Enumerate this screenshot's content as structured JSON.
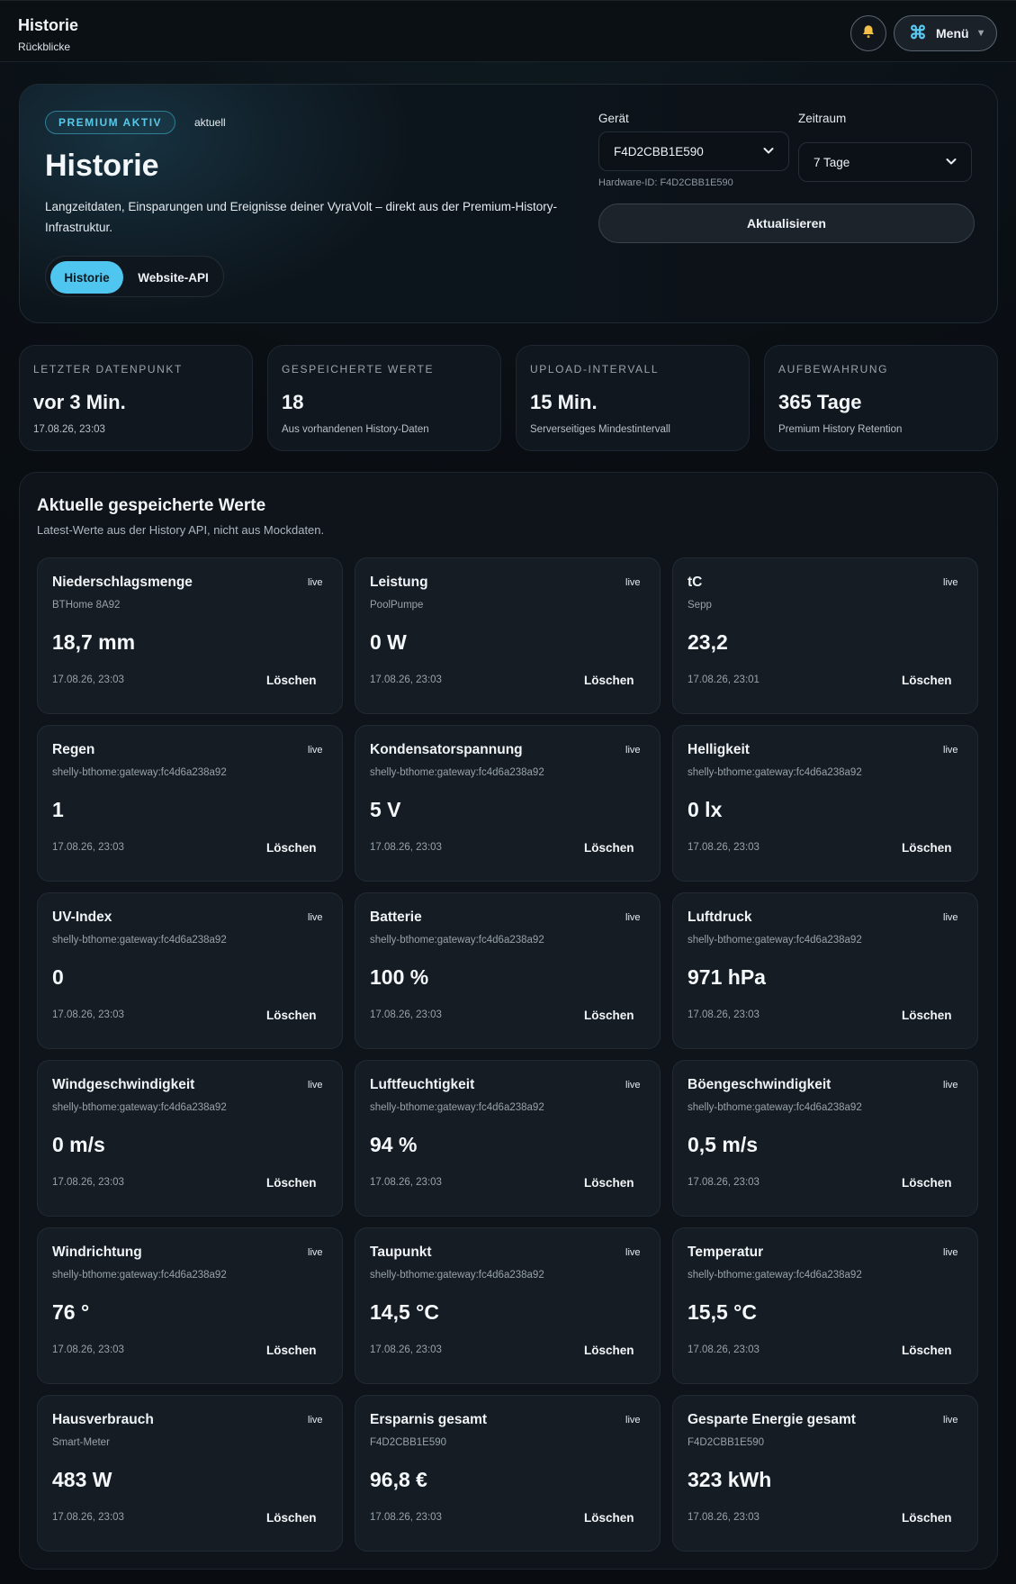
{
  "header": {
    "title": "Historie",
    "subtitle": "Rückblicke",
    "menu_label": "Menü"
  },
  "hero": {
    "badge": "PREMIUM AKTIV",
    "badge_note": "aktuell",
    "title": "Historie",
    "description": "Langzeitdaten, Einsparungen und Ereignisse deiner VyraVolt – direkt aus der Premium-History-Infrastruktur.",
    "tabs": [
      "Historie",
      "Website-API"
    ],
    "device_label": "Gerät",
    "device_value": "F4D2CBB1E590",
    "hardware_id": "Hardware-ID: F4D2CBB1E590",
    "range_label": "Zeitraum",
    "range_value": "7 Tage",
    "refresh_label": "Aktualisieren"
  },
  "stats": [
    {
      "key": "LETZTER DATENPUNKT",
      "value": "vor 3 Min.",
      "detail": "17.08.26, 23:03"
    },
    {
      "key": "GESPEICHERTE WERTE",
      "value": "18",
      "detail": "Aus vorhandenen History-Daten"
    },
    {
      "key": "UPLOAD-INTERVALL",
      "value": "15 Min.",
      "detail": "Serverseitiges Mindestintervall"
    },
    {
      "key": "AUFBEWAHRUNG",
      "value": "365 Tage",
      "detail": "Premium History Retention"
    }
  ],
  "values_section": {
    "title": "Aktuelle gespeicherte Werte",
    "subtitle": "Latest-Werte aus der History API, nicht aus Mockdaten.",
    "live_label": "live",
    "delete_label": "Löschen",
    "cards": [
      {
        "name": "Niederschlagsmenge",
        "source": "BTHome 8A92",
        "value": "18,7 mm",
        "time": "17.08.26, 23:03"
      },
      {
        "name": "Leistung",
        "source": "PoolPumpe",
        "value": "0 W",
        "time": "17.08.26, 23:03"
      },
      {
        "name": "tC",
        "source": "Sepp",
        "value": "23,2",
        "time": "17.08.26, 23:01"
      },
      {
        "name": "Regen",
        "source": "shelly-bthome:gateway:fc4d6a238a92",
        "value": "1",
        "time": "17.08.26, 23:03"
      },
      {
        "name": "Kondensatorspannung",
        "source": "shelly-bthome:gateway:fc4d6a238a92",
        "value": "5 V",
        "time": "17.08.26, 23:03"
      },
      {
        "name": "Helligkeit",
        "source": "shelly-bthome:gateway:fc4d6a238a92",
        "value": "0 lx",
        "time": "17.08.26, 23:03"
      },
      {
        "name": "UV-Index",
        "source": "shelly-bthome:gateway:fc4d6a238a92",
        "value": "0",
        "time": "17.08.26, 23:03"
      },
      {
        "name": "Batterie",
        "source": "shelly-bthome:gateway:fc4d6a238a92",
        "value": "100 %",
        "time": "17.08.26, 23:03"
      },
      {
        "name": "Luftdruck",
        "source": "shelly-bthome:gateway:fc4d6a238a92",
        "value": "971 hPa",
        "time": "17.08.26, 23:03"
      },
      {
        "name": "Windgeschwindigkeit",
        "source": "shelly-bthome:gateway:fc4d6a238a92",
        "value": "0 m/s",
        "time": "17.08.26, 23:03"
      },
      {
        "name": "Luftfeuchtigkeit",
        "source": "shelly-bthome:gateway:fc4d6a238a92",
        "value": "94 %",
        "time": "17.08.26, 23:03"
      },
      {
        "name": "Böengeschwindigkeit",
        "source": "shelly-bthome:gateway:fc4d6a238a92",
        "value": "0,5 m/s",
        "time": "17.08.26, 23:03"
      },
      {
        "name": "Windrichtung",
        "source": "shelly-bthome:gateway:fc4d6a238a92",
        "value": "76 °",
        "time": "17.08.26, 23:03"
      },
      {
        "name": "Taupunkt",
        "source": "shelly-bthome:gateway:fc4d6a238a92",
        "value": "14,5 °C",
        "time": "17.08.26, 23:03"
      },
      {
        "name": "Temperatur",
        "source": "shelly-bthome:gateway:fc4d6a238a92",
        "value": "15,5 °C",
        "time": "17.08.26, 23:03"
      },
      {
        "name": "Hausverbrauch",
        "source": "Smart-Meter",
        "value": "483 W",
        "time": "17.08.26, 23:03"
      },
      {
        "name": "Ersparnis gesamt",
        "source": "F4D2CBB1E590",
        "value": "96,8 €",
        "time": "17.08.26, 23:03"
      },
      {
        "name": "Gesparte Energie gesamt",
        "source": "F4D2CBB1E590",
        "value": "323 kWh",
        "time": "17.08.26, 23:03"
      }
    ]
  },
  "colors": {
    "accent": "#4fc6f0",
    "background": "#0a0f14"
  },
  "icons": {
    "notifications": "bell-icon",
    "menu": "command-icon",
    "dropdown": "chevron-down-icon"
  }
}
